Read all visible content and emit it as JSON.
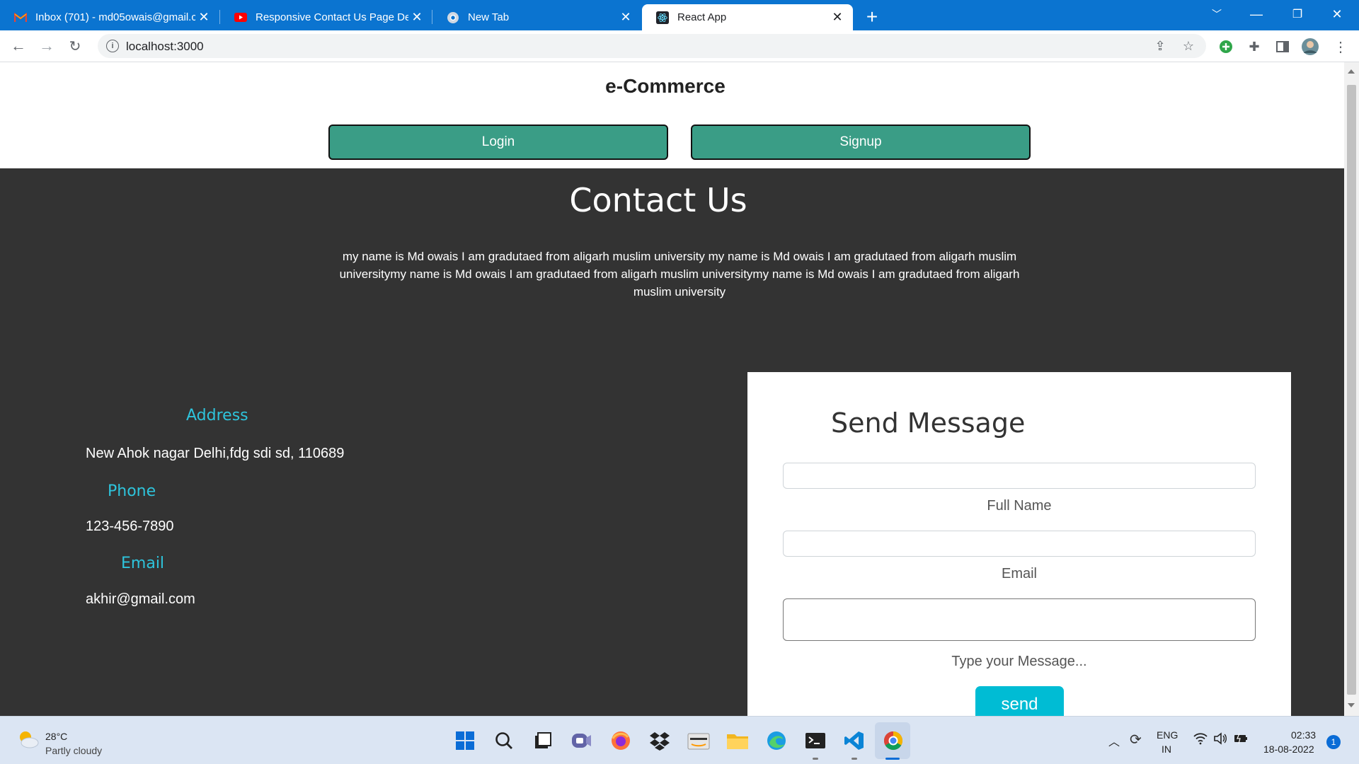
{
  "browser": {
    "tabs": [
      {
        "title": "Inbox (701) - md05owais@gmail.c",
        "icon": "gmail-icon"
      },
      {
        "title": "Responsive Contact Us Page Desi",
        "icon": "youtube-icon"
      },
      {
        "title": "New Tab",
        "icon": "chrome-icon"
      },
      {
        "title": "React App",
        "icon": "react-icon"
      }
    ],
    "url": "localhost:3000"
  },
  "header": {
    "title": "e-Commerce",
    "login_label": "Login",
    "signup_label": "Signup"
  },
  "contact": {
    "title": "Contact Us",
    "description": "my name is Md owais I am gradutaed from aligarh muslim university my name is Md owais I am gradutaed from aligarh muslim universitymy name is Md owais I am gradutaed from aligarh muslim universitymy name is Md owais I am gradutaed from aligarh muslim university",
    "address_label": "Address",
    "address_value": "New Ahok nagar Delhi,fdg sdi sd, 110689",
    "phone_label": "Phone",
    "phone_value": "123-456-7890",
    "email_label": "Email",
    "email_value": "akhir@gmail.com"
  },
  "form": {
    "title": "Send Message",
    "fullname_label": "Full Name",
    "email_label": "Email",
    "message_label": "Type your Message...",
    "send_label": "send"
  },
  "taskbar": {
    "weather_temp": "28°C",
    "weather_desc": "Partly cloudy",
    "lang_top": "ENG",
    "lang_bottom": "IN",
    "time": "02:33",
    "date": "18-08-2022",
    "notification_count": "1"
  },
  "colors": {
    "accent_tab_bar": "#0b74d0",
    "button_green": "#3a9d86",
    "contact_bg": "#333333",
    "label_cyan": "#2ec4dc",
    "send_button": "#00bcd4"
  }
}
